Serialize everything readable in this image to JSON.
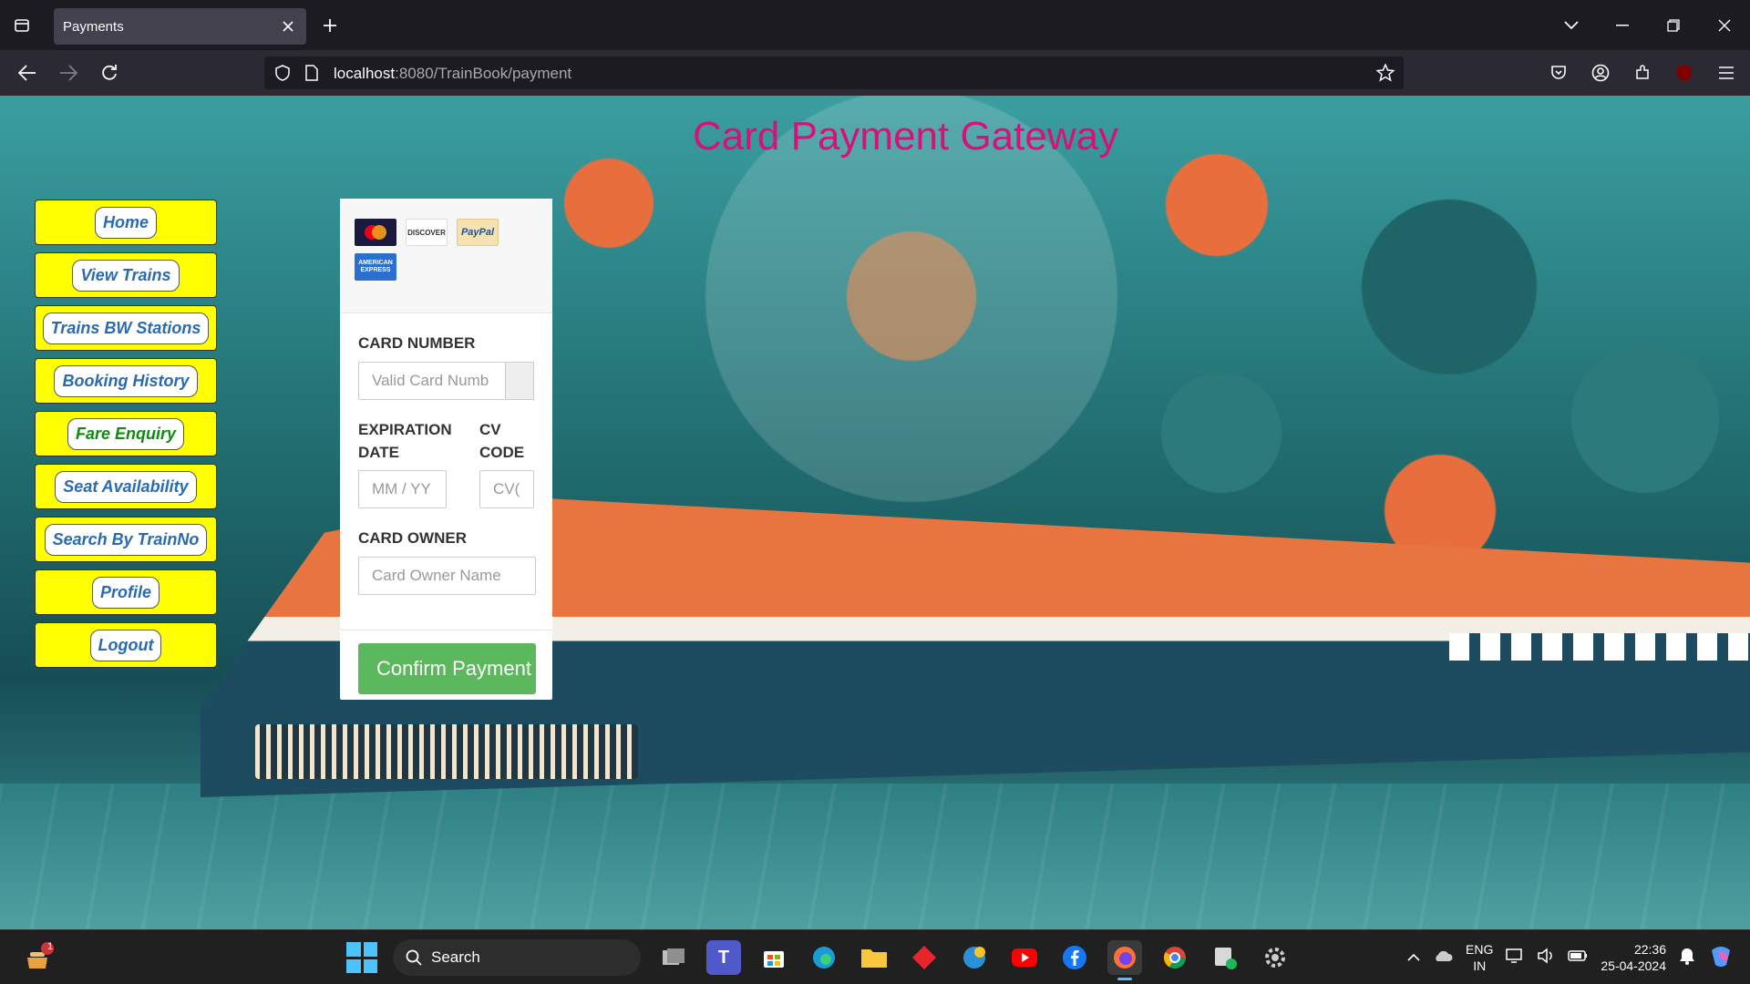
{
  "browser": {
    "tab_title": "Payments",
    "url_host": "localhost",
    "url_rest": ":8080/TrainBook/payment"
  },
  "page": {
    "title": "Card Payment Gateway",
    "menu": [
      {
        "label": "Home"
      },
      {
        "label": "View Trains"
      },
      {
        "label": "Trains BW Stations"
      },
      {
        "label": "Booking History"
      },
      {
        "label": "Fare Enquiry"
      },
      {
        "label": "Seat Availability"
      },
      {
        "label": "Search By TrainNo"
      },
      {
        "label": "Profile"
      },
      {
        "label": "Logout"
      }
    ],
    "card_logos": [
      "MasterCard",
      "DISCOVER",
      "PayPal",
      "AMERICAN EXPRESS"
    ],
    "form": {
      "card_number_label": "CARD NUMBER",
      "card_number_placeholder": "Valid Card Numb",
      "expiration_label_1": "EXPIRATION",
      "expiration_label_2": "DATE",
      "expiration_placeholder": "MM / YY",
      "cv_label_1": "CV",
      "cv_label_2": "CODE",
      "cv_placeholder": "CV(",
      "owner_label": "CARD OWNER",
      "owner_placeholder": "Card Owner Name",
      "confirm_label": "Confirm Payment"
    }
  },
  "taskbar": {
    "search_label": "Search",
    "language_1": "ENG",
    "language_2": "IN",
    "time": "22:36",
    "date": "25-04-2024",
    "notification_badge": "1"
  },
  "colors": {
    "title": "#d6127a",
    "menu_bg": "#ffff00",
    "confirm_bg": "#5cb85c"
  }
}
